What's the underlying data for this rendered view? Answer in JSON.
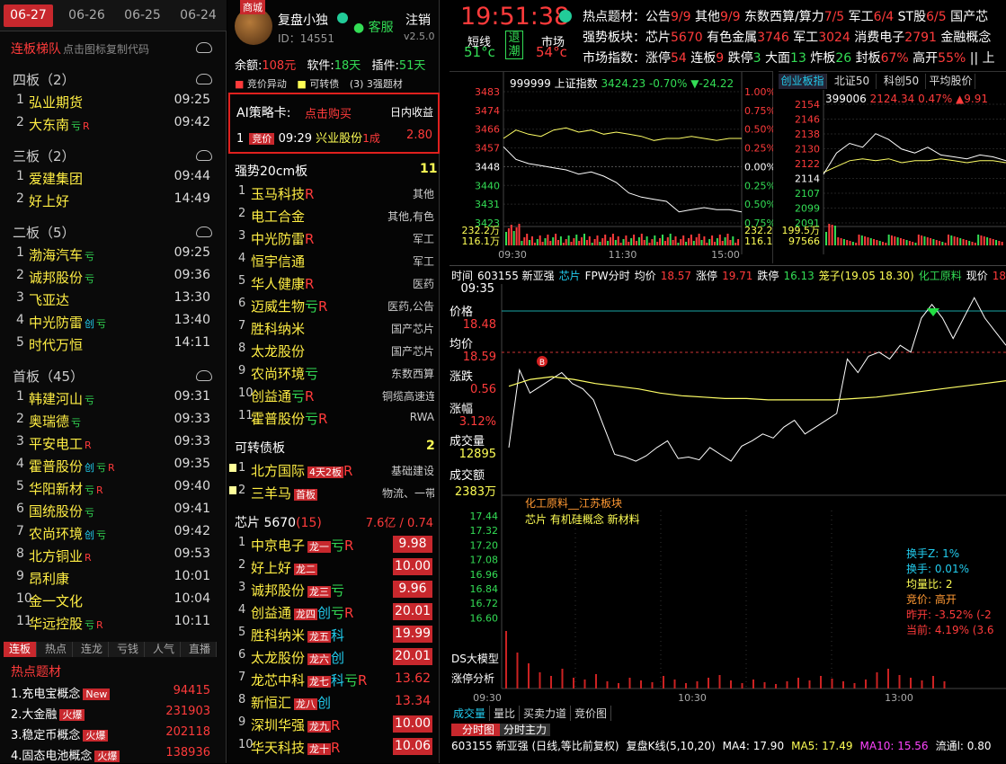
{
  "dates": [
    "06-27",
    "06-26",
    "06-25",
    "06-24"
  ],
  "ladder": {
    "title": "连板梯队",
    "hint": "点击图标复制代码",
    "sections": [
      {
        "label": "四板（2）",
        "rows": [
          {
            "n": "1",
            "name": "弘业期货",
            "tag": "",
            "t": "09:25"
          },
          {
            "n": "2",
            "name": "大东南",
            "tag": "亏R",
            "t": "09:42"
          }
        ]
      },
      {
        "label": "三板（2）",
        "rows": [
          {
            "n": "1",
            "name": "爱建集团",
            "tag": "",
            "t": "09:44"
          },
          {
            "n": "2",
            "name": "好上好",
            "tag": "",
            "t": "14:49"
          }
        ]
      },
      {
        "label": "二板（5）",
        "rows": [
          {
            "n": "1",
            "name": "渤海汽车",
            "tag": "亏",
            "t": "09:25"
          },
          {
            "n": "2",
            "name": "诚邦股份",
            "tag": "亏",
            "t": "09:36"
          },
          {
            "n": "3",
            "name": "飞亚达",
            "tag": "",
            "t": "13:30"
          },
          {
            "n": "4",
            "name": "中光防雷",
            "tag": "创亏",
            "t": "13:40"
          },
          {
            "n": "5",
            "name": "时代万恒",
            "tag": "",
            "t": "14:11"
          }
        ]
      },
      {
        "label": "首板（45）",
        "rows": [
          {
            "n": "1",
            "name": "韩建河山",
            "tag": "亏",
            "t": "09:31"
          },
          {
            "n": "2",
            "name": "奥瑞德",
            "tag": "亏",
            "t": "09:33"
          },
          {
            "n": "3",
            "name": "平安电工",
            "tag": "R",
            "t": "09:33"
          },
          {
            "n": "4",
            "name": "霍普股份",
            "tag": "创亏R",
            "t": "09:35"
          },
          {
            "n": "5",
            "name": "华阳新材",
            "tag": "亏R",
            "t": "09:40"
          },
          {
            "n": "6",
            "name": "国统股份",
            "tag": "亏",
            "t": "09:41"
          },
          {
            "n": "7",
            "name": "农尚环境",
            "tag": "创亏",
            "t": "09:42"
          },
          {
            "n": "8",
            "name": "北方铜业",
            "tag": "R",
            "t": "09:53"
          },
          {
            "n": "9",
            "name": "昂利康",
            "tag": "",
            "t": "10:01"
          },
          {
            "n": "10",
            "name": "金一文化",
            "tag": "",
            "t": "10:04"
          },
          {
            "n": "11",
            "name": "华远控股",
            "tag": "亏R",
            "t": "10:11"
          }
        ]
      }
    ]
  },
  "bottom_tabs": [
    "连板",
    "热点",
    "连龙",
    "亏钱",
    "人气",
    "直播"
  ],
  "hot_topics": {
    "title": "热点题材",
    "rows": [
      {
        "name": "1.充电宝概念",
        "badge": "New",
        "val": "94415"
      },
      {
        "name": "2.大金融",
        "badge": "火爆",
        "val": "231903"
      },
      {
        "name": "3.稳定币概念",
        "badge": "火爆",
        "val": "202118"
      },
      {
        "name": "4.固态电池概念",
        "badge": "火爆",
        "val": "138936"
      }
    ]
  },
  "user": {
    "shop": "商城",
    "name": "复盘小独",
    "id": "ID：14551",
    "service": "客服",
    "logout": "注销",
    "version": "v2.5.0"
  },
  "account": {
    "balance_label": "余额:",
    "balance": "108元",
    "software_label": "软件:",
    "software": "18天",
    "plugin_label": "插件:",
    "plugin": "51天"
  },
  "legend": [
    "竞价异动",
    "可转债",
    "(3) 3强题材"
  ],
  "ai_card": {
    "title": "AI策略卡:",
    "buy": "点击购买",
    "profit": "日内收益",
    "row": {
      "n": "1",
      "tag": "竞价",
      "time": "09:29",
      "name": "兴业股份",
      "board": "1成",
      "val": "2.80"
    }
  },
  "strong20": {
    "title": "强势20cm板",
    "count": "11",
    "rows": [
      {
        "n": "1",
        "name": "玉马科技",
        "tag": "R",
        "cat": "其他"
      },
      {
        "n": "2",
        "name": "电工合金",
        "tag": "",
        "cat": "其他,有色"
      },
      {
        "n": "3",
        "name": "中光防雷",
        "tag": "R",
        "cat": "军工"
      },
      {
        "n": "4",
        "name": "恒宇信通",
        "tag": "",
        "cat": "军工"
      },
      {
        "n": "5",
        "name": "华人健康",
        "tag": "R",
        "cat": "医药"
      },
      {
        "n": "6",
        "name": "迈威生物",
        "tag": "亏R",
        "cat": "医药,公告"
      },
      {
        "n": "7",
        "name": "胜科纳米",
        "tag": "",
        "cat": "国产芯片"
      },
      {
        "n": "8",
        "name": "太龙股份",
        "tag": "",
        "cat": "国产芯片"
      },
      {
        "n": "9",
        "name": "农尚环境",
        "tag": "亏",
        "cat": "东数西算"
      },
      {
        "n": "10",
        "name": "创益通",
        "tag": "亏R",
        "cat": "铜缆高速连"
      },
      {
        "n": "11",
        "name": "霍普股份",
        "tag": "亏R",
        "cat": "RWA"
      }
    ]
  },
  "convert": {
    "title": "可转债板",
    "count": "2",
    "rows": [
      {
        "n": "1",
        "name": "北方国际",
        "badge": "4天2板",
        "tag": "R",
        "cat": "基础建设"
      },
      {
        "n": "2",
        "name": "三羊马",
        "badge": "首板",
        "tag": "",
        "cat": "物流、一带"
      }
    ]
  },
  "chip": {
    "title": "芯片",
    "code": "5670",
    "count": "(15)",
    "amt": "7.6亿 / 0.74",
    "rows": [
      {
        "n": "1",
        "name": "中京电子",
        "lb": "龙一",
        "tag": "亏R",
        "val": "9.98",
        "box": true
      },
      {
        "n": "2",
        "name": "好上好",
        "lb": "龙二",
        "tag": "",
        "val": "10.00",
        "box": true
      },
      {
        "n": "3",
        "name": "诚邦股份",
        "lb": "龙三",
        "tag": "亏",
        "val": "9.96",
        "box": true
      },
      {
        "n": "4",
        "name": "创益通",
        "lb": "龙四",
        "tag": "创亏R",
        "val": "20.01",
        "box": true
      },
      {
        "n": "5",
        "name": "胜科纳米",
        "lb": "龙五",
        "tag": "科",
        "val": "19.99",
        "box": true
      },
      {
        "n": "6",
        "name": "太龙股份",
        "lb": "龙六",
        "tag": "创",
        "val": "20.01",
        "box": true
      },
      {
        "n": "7",
        "name": "龙芯中科",
        "lb": "龙七",
        "tag": "科亏R",
        "val": "13.62",
        "box": false
      },
      {
        "n": "8",
        "name": "新恒汇",
        "lb": "龙八",
        "tag": "创",
        "val": "13.34",
        "box": false
      },
      {
        "n": "9",
        "name": "深圳华强",
        "lb": "龙九",
        "tag": "R",
        "val": "10.00",
        "box": true
      },
      {
        "n": "10",
        "name": "华天科技",
        "lb": "龙十",
        "tag": "R",
        "val": "10.06",
        "box": true
      }
    ]
  },
  "top": {
    "clock": "19:51:38",
    "short_label": "短线",
    "short_val": "51°c",
    "retreat": "退潮",
    "mkt_label": "市场",
    "mkt_val": "54°c",
    "line1": [
      {
        "t": "热点题材：",
        "c": "wht"
      },
      {
        "t": "公告",
        "c": "wht"
      },
      {
        "t": "9/9",
        "c": "red"
      },
      {
        "t": " 其他",
        "c": "wht"
      },
      {
        "t": "9/9",
        "c": "red"
      },
      {
        "t": " 东数西算/算力",
        "c": "wht"
      },
      {
        "t": "7/5",
        "c": "red"
      },
      {
        "t": " 军工",
        "c": "wht"
      },
      {
        "t": "6/4",
        "c": "red"
      },
      {
        "t": " ST股",
        "c": "wht"
      },
      {
        "t": "6/5",
        "c": "red"
      },
      {
        "t": " 国产芯",
        "c": "wht"
      }
    ],
    "line2": [
      {
        "t": "强势板块：",
        "c": "wht"
      },
      {
        "t": "芯片",
        "c": "wht"
      },
      {
        "t": "5670",
        "c": "red"
      },
      {
        "t": " 有色金属",
        "c": "wht"
      },
      {
        "t": "3746",
        "c": "red"
      },
      {
        "t": " 军工",
        "c": "wht"
      },
      {
        "t": "3024",
        "c": "red"
      },
      {
        "t": " 消费电子",
        "c": "wht"
      },
      {
        "t": "2791",
        "c": "red"
      },
      {
        "t": " 金融概念",
        "c": "wht"
      }
    ],
    "line3": [
      {
        "t": "市场指数：",
        "c": "wht"
      },
      {
        "t": "涨停",
        "c": "wht"
      },
      {
        "t": "54",
        "c": "red"
      },
      {
        "t": " 连板",
        "c": "wht"
      },
      {
        "t": "9",
        "c": "red"
      },
      {
        "t": " 跌停",
        "c": "wht"
      },
      {
        "t": "3",
        "c": "grn"
      },
      {
        "t": " 大面",
        "c": "wht"
      },
      {
        "t": "13",
        "c": "grn"
      },
      {
        "t": " 炸板",
        "c": "wht"
      },
      {
        "t": "26",
        "c": "grn"
      },
      {
        "t": " 封板",
        "c": "wht"
      },
      {
        "t": "67%",
        "c": "red"
      },
      {
        "t": " 高开",
        "c": "wht"
      },
      {
        "t": "55%",
        "c": "red"
      },
      {
        "t": " ||",
        "c": "wht"
      },
      {
        "t": " 上",
        "c": "wht"
      }
    ]
  },
  "index_chart": {
    "code": "999999",
    "name": "上证指数",
    "price": "3424.23",
    "pct": "-0.70%",
    "chg": "▼-24.22",
    "yleft": [
      "3483",
      "3474",
      "3466",
      "3457",
      "3448",
      "3440",
      "3431",
      "3423"
    ],
    "yright": [
      "1.00%",
      "0.75%",
      "0.50%",
      "0.25%",
      "0.00%",
      "0.25%",
      "0.50%",
      "0.75%"
    ],
    "vol1": "232.2万",
    "vol2": "116.1万",
    "xt": [
      "09:30",
      "11:30",
      "15:00"
    ],
    "series_white": [
      3458,
      3452,
      3450,
      3449,
      3448,
      3447,
      3445,
      3446,
      3444,
      3441,
      3436,
      3434,
      3433,
      3432,
      3427,
      3428,
      3429,
      3428,
      3428,
      3427
    ],
    "series_yellow": [
      3462,
      3466,
      3464,
      3463,
      3466,
      3467,
      3465,
      3466,
      3464,
      3465,
      3464,
      3463,
      3461,
      3462,
      3462,
      3463,
      3462,
      3461,
      3462,
      3462
    ]
  },
  "cyb_chart": {
    "tabs": [
      "创业板指",
      "北证50",
      "科创50",
      "平均股价"
    ],
    "code": "399006",
    "price": "2124.34",
    "pct": "0.47%",
    "chg": "▲9.91",
    "yleft": [
      "2154",
      "2146",
      "2138",
      "2130",
      "2122",
      "2114",
      "2107",
      "2099",
      "2091"
    ],
    "vol1": "199.5万",
    "vol2": "97566",
    "series_white": [
      2117,
      2128,
      2133,
      2131,
      2138,
      2135,
      2130,
      2128,
      2131,
      2127,
      2126,
      2125,
      2127,
      2126,
      2124
    ],
    "series_yellow": [
      2118,
      2121,
      2124,
      2125,
      2124,
      2125,
      2123,
      2124,
      2124,
      2125,
      2124,
      2123,
      2124,
      2124,
      2123
    ]
  },
  "stock_chart": {
    "hdr": [
      {
        "t": "时间",
        "c": "wht"
      },
      {
        "t": "603155 新亚强",
        "c": "wht"
      },
      {
        "t": "芯片",
        "c": "cyan"
      },
      {
        "t": "FPW分时",
        "c": "wht"
      },
      {
        "t": "均价",
        "c": "wht"
      },
      {
        "t": "18.57",
        "c": "red"
      },
      {
        "t": "涨停",
        "c": "wht"
      },
      {
        "t": "19.71",
        "c": "red"
      },
      {
        "t": "跌停",
        "c": "wht"
      },
      {
        "t": "16.13",
        "c": "grn"
      },
      {
        "t": "笼子(19.05 18.30)",
        "c": "yel"
      },
      {
        "t": "化工原料",
        "c": "grn"
      },
      {
        "t": "现价",
        "c": "wht"
      },
      {
        "t": "18.6",
        "c": "red"
      }
    ],
    "info_time": "09:35",
    "price_lbl": "价格",
    "price": "18.48",
    "avg_lbl": "均价",
    "avg": "18.59",
    "chg_lbl": "涨跌",
    "chg": "0.56",
    "pct_lbl": "涨幅",
    "pct": "3.12%",
    "vol_lbl": "成交量",
    "vol": "12895",
    "amt_lbl": "成交额",
    "amt": "2383万",
    "ylevels": [
      "17.44",
      "17.32",
      "17.20",
      "17.08",
      "16.96",
      "16.84",
      "16.72",
      "16.60"
    ],
    "note1": "化工原料__江苏板块",
    "note2": "芯片 有机硅概念 新材料",
    "ds": "DS大模型",
    "zt": "涨停分析",
    "side": [
      {
        "t": "换手Z: 1%",
        "c": "cyan"
      },
      {
        "t": "换手: 0.01%",
        "c": "cyan"
      },
      {
        "t": "均量比: 2",
        "c": "yel"
      },
      {
        "t": "竞价: 高开",
        "c": "org"
      },
      {
        "t": "昨开: -3.52% (-2",
        "c": "red"
      },
      {
        "t": "当前: 4.19% (3.6",
        "c": "red"
      }
    ],
    "xt": [
      "09:30",
      "10:30",
      "13:00"
    ],
    "price_series": [
      18.05,
      18.62,
      18.45,
      18.5,
      18.55,
      18.6,
      18.52,
      18.48,
      18.4,
      18.2,
      18.0,
      17.98,
      17.95,
      17.99,
      18.05,
      18.1,
      17.97,
      17.98,
      17.96,
      18.05,
      18.0,
      17.95,
      18.06,
      18.1,
      18.15,
      18.12,
      18.2,
      18.25,
      18.15,
      18.2,
      18.25,
      18.3,
      18.7,
      18.6,
      18.72,
      18.75,
      18.7,
      18.8,
      18.75,
      19.0,
      19.1,
      19.0,
      18.85,
      19.0,
      19.15,
      19.0,
      18.9,
      18.8
    ],
    "avg_series": [
      18.5,
      18.55,
      18.57,
      18.55,
      18.52,
      18.5,
      18.48,
      18.45,
      18.43,
      18.42,
      18.41,
      18.41,
      18.4,
      18.4,
      18.4,
      18.4,
      18.41,
      18.42,
      18.44,
      18.46,
      18.48,
      18.5,
      18.52,
      18.54
    ]
  },
  "bottom": {
    "tabs": [
      "成交量",
      "量比",
      "买卖力道",
      "竞价图"
    ],
    "tabs2": [
      "分时图",
      "分时主力"
    ],
    "info": [
      {
        "t": "603155 新亚强 (日线,等比前复权)",
        "c": "wht"
      },
      {
        "t": "复盘K线(5,10,20)",
        "c": "wht"
      },
      {
        "t": "MA4: 17.90",
        "c": "wht"
      },
      {
        "t": "MA5: 17.49",
        "c": "yel"
      },
      {
        "t": "MA10: 15.56",
        "c": "mag"
      },
      {
        "t": "流通l: 0.80",
        "c": "wht"
      }
    ]
  }
}
